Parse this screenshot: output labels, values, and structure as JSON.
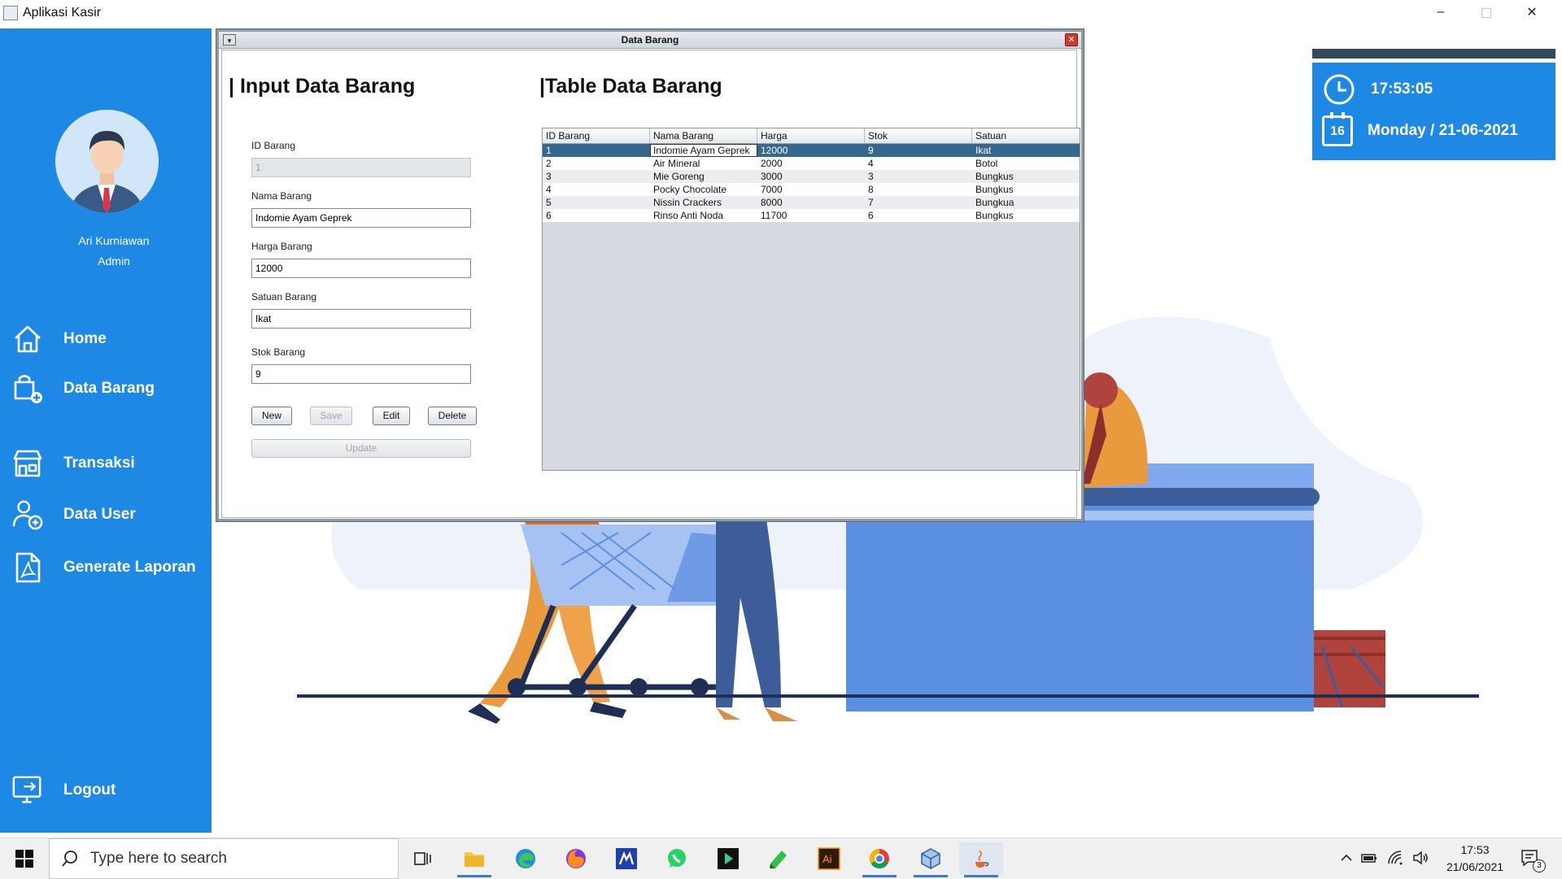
{
  "window": {
    "title": "Aplikasi Kasir",
    "minimize": "–",
    "maximize": "▢",
    "close": "✕"
  },
  "sidebar": {
    "user_name": "Ari Kurniawan",
    "user_role": "Admin",
    "items": [
      {
        "label": "Home",
        "icon": "home-icon"
      },
      {
        "label": "Data Barang",
        "icon": "box-add-icon"
      },
      {
        "label": "Transaksi",
        "icon": "store-icon"
      },
      {
        "label": "Data User",
        "icon": "user-add-icon"
      },
      {
        "label": "Generate Laporan",
        "icon": "pdf-document-icon"
      },
      {
        "label": "Logout",
        "icon": "logout-icon"
      }
    ]
  },
  "clock": {
    "time": "17:53:05",
    "date": "Monday / 21-06-2021",
    "calendar_day": "16"
  },
  "frame": {
    "title": "Data Barang",
    "input_title": "| Input Data Barang",
    "table_title": "|Table Data Barang",
    "form": {
      "id_label": "ID Barang",
      "id_value": "1",
      "nama_label": "Nama Barang",
      "nama_value": "Indomie Ayam Geprek",
      "harga_label": "Harga Barang",
      "harga_value": "12000",
      "satuan_label": "Satuan Barang",
      "satuan_value": "Ikat",
      "stok_label": "Stok Barang",
      "stok_value": "9"
    },
    "buttons": {
      "new": "New",
      "save": "Save",
      "edit": "Edit",
      "delete": "Delete",
      "update": "Update"
    },
    "table": {
      "headers": [
        "ID Barang",
        "Nama Barang",
        "Harga",
        "Stok",
        "Satuan"
      ],
      "rows": [
        [
          "1",
          "Indomie Ayam Geprek",
          "12000",
          "9",
          "Ikat"
        ],
        [
          "2",
          "Air Mineral",
          "2000",
          "4",
          "Botol"
        ],
        [
          "3",
          "Mie Goreng",
          "3000",
          "3",
          "Bungkus"
        ],
        [
          "4",
          "Pocky Chocolate",
          "7000",
          "8",
          "Bungkus"
        ],
        [
          "5",
          "Nissin Crackers",
          "8000",
          "7",
          "Bungkua"
        ],
        [
          "6",
          "Rinso Anti Noda",
          "11700",
          "6",
          "Bungkus"
        ]
      ],
      "selected_row": 0
    }
  },
  "taskbar": {
    "search_placeholder": "Type here to search",
    "time": "17:53",
    "date": "21/06/2021",
    "notification_count": "3",
    "apps": [
      "task-view",
      "file-explorer",
      "edge",
      "firefox",
      "app-m",
      "whatsapp",
      "app-arrow",
      "app-green",
      "illustrator",
      "chrome",
      "virtualbox",
      "java"
    ]
  },
  "colors": {
    "sidebar": "#1e88e5",
    "selected_row": "#36688f",
    "illustration_blue": "#5b8fe0"
  }
}
